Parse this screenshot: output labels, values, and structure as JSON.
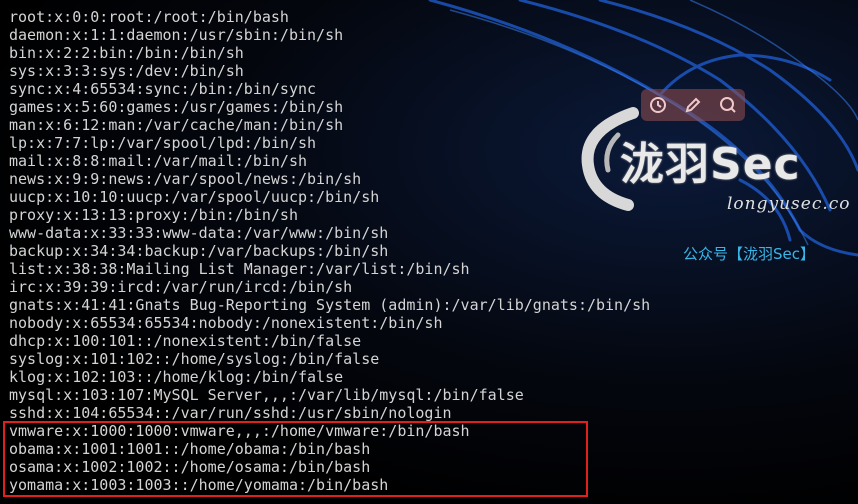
{
  "terminal": {
    "lines": [
      "root:x:0:0:root:/root:/bin/bash",
      "daemon:x:1:1:daemon:/usr/sbin:/bin/sh",
      "bin:x:2:2:bin:/bin:/bin/sh",
      "sys:x:3:3:sys:/dev:/bin/sh",
      "sync:x:4:65534:sync:/bin:/bin/sync",
      "games:x:5:60:games:/usr/games:/bin/sh",
      "man:x:6:12:man:/var/cache/man:/bin/sh",
      "lp:x:7:7:lp:/var/spool/lpd:/bin/sh",
      "mail:x:8:8:mail:/var/mail:/bin/sh",
      "news:x:9:9:news:/var/spool/news:/bin/sh",
      "uucp:x:10:10:uucp:/var/spool/uucp:/bin/sh",
      "proxy:x:13:13:proxy:/bin:/bin/sh",
      "www-data:x:33:33:www-data:/var/www:/bin/sh",
      "backup:x:34:34:backup:/var/backups:/bin/sh",
      "list:x:38:38:Mailing List Manager:/var/list:/bin/sh",
      "irc:x:39:39:ircd:/var/run/ircd:/bin/sh",
      "gnats:x:41:41:Gnats Bug-Reporting System (admin):/var/lib/gnats:/bin/sh",
      "nobody:x:65534:65534:nobody:/nonexistent:/bin/sh",
      "dhcp:x:100:101::/nonexistent:/bin/false",
      "syslog:x:101:102::/home/syslog:/bin/false",
      "klog:x:102:103::/home/klog:/bin/false",
      "mysql:x:103:107:MySQL Server,,,:/var/lib/mysql:/bin/false",
      "sshd:x:104:65534::/var/run/sshd:/usr/sbin/nologin",
      "vmware:x:1000:1000:vmware,,,:/home/vmware:/bin/bash",
      "obama:x:1001:1001::/home/obama:/bin/bash",
      "osama:x:1002:1002::/home/osama:/bin/bash",
      "yomama:x:1003:1003::/home/yomama:/bin/bash"
    ],
    "highlighted_lines": [
      23,
      24,
      25,
      26
    ],
    "text_color": "#d4d4d4",
    "highlight_color": "#e0201a"
  },
  "watermark": {
    "title": "泷羽Sec",
    "domain": "longyusec.co",
    "wechat": "公众号【泷羽Sec】",
    "toolbar_icons": [
      "clock-icon",
      "edit-icon",
      "search-icon"
    ],
    "accent_color": "#39b6e8"
  }
}
